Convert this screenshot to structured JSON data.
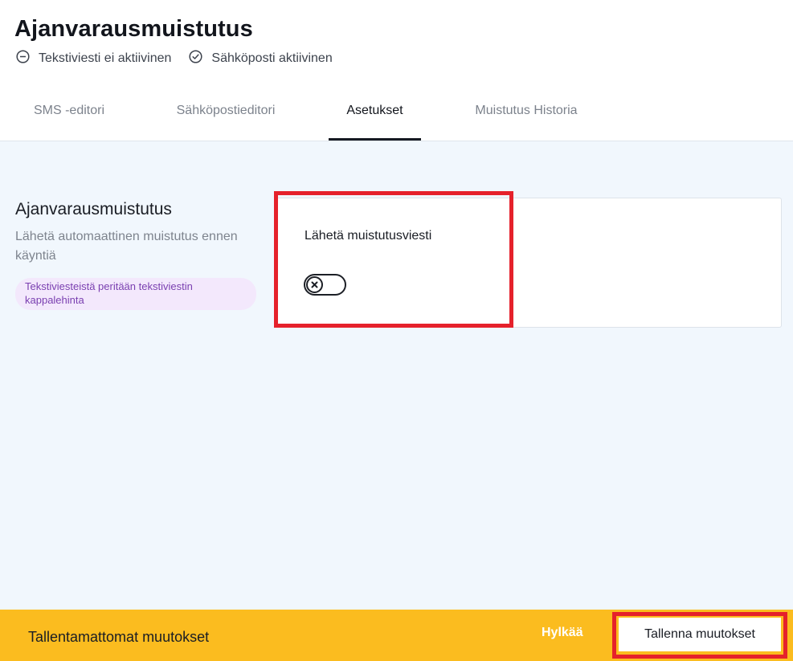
{
  "header": {
    "title": "Ajanvarausmuistutus",
    "status": [
      {
        "label": "Tekstiviesti ei aktiivinen",
        "icon": "minus-circle-icon"
      },
      {
        "label": "Sähköposti aktiivinen",
        "icon": "check-circle-icon"
      }
    ]
  },
  "tabs": [
    {
      "label": "SMS -editori",
      "active": false
    },
    {
      "label": "Sähköpostieditori",
      "active": false
    },
    {
      "label": "Asetukset",
      "active": true
    },
    {
      "label": "Muistutus Historia",
      "active": false
    }
  ],
  "settings": {
    "section_title": "Ajanvarausmuistutus",
    "section_description": "Lähetä automaattinen muistutus ennen käyntiä",
    "note": "Tekstiviesteistä peritään tekstiviestin kappalehinta",
    "card": {
      "label": "Lähetä muistutusviesti",
      "toggle_enabled": false,
      "toggle_icon": "close-x-icon"
    }
  },
  "bottom_bar": {
    "message": "Tallentamattomat muutokset",
    "discard_label": "Hylkää",
    "save_label": "Tallenna muutokset"
  },
  "colors": {
    "accent_bar": "#fbbc1f",
    "content_background": "#f1f7fd",
    "highlight": "#e5212b",
    "note_background": "#f3e8fc",
    "note_text": "#7a3fb0"
  }
}
